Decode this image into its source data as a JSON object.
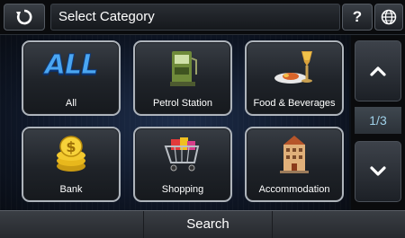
{
  "header": {
    "title": "Select Category",
    "help_label": "?"
  },
  "categories": [
    {
      "label": "All",
      "icon": "all-icon"
    },
    {
      "label": "Petrol Station",
      "icon": "petrol-pump-icon"
    },
    {
      "label": "Food & Beverages",
      "icon": "food-plate-icon"
    },
    {
      "label": "Bank",
      "icon": "coins-icon"
    },
    {
      "label": "Shopping",
      "icon": "shopping-cart-icon"
    },
    {
      "label": "Accommodation",
      "icon": "hotel-building-icon"
    }
  ],
  "pager": {
    "indicator": "1/3"
  },
  "footer": {
    "search_label": "Search"
  },
  "icon_text": {
    "all": "ALL"
  },
  "colors": {
    "accent": "#9fd0e8",
    "tile_border": "#aeb4bb"
  }
}
